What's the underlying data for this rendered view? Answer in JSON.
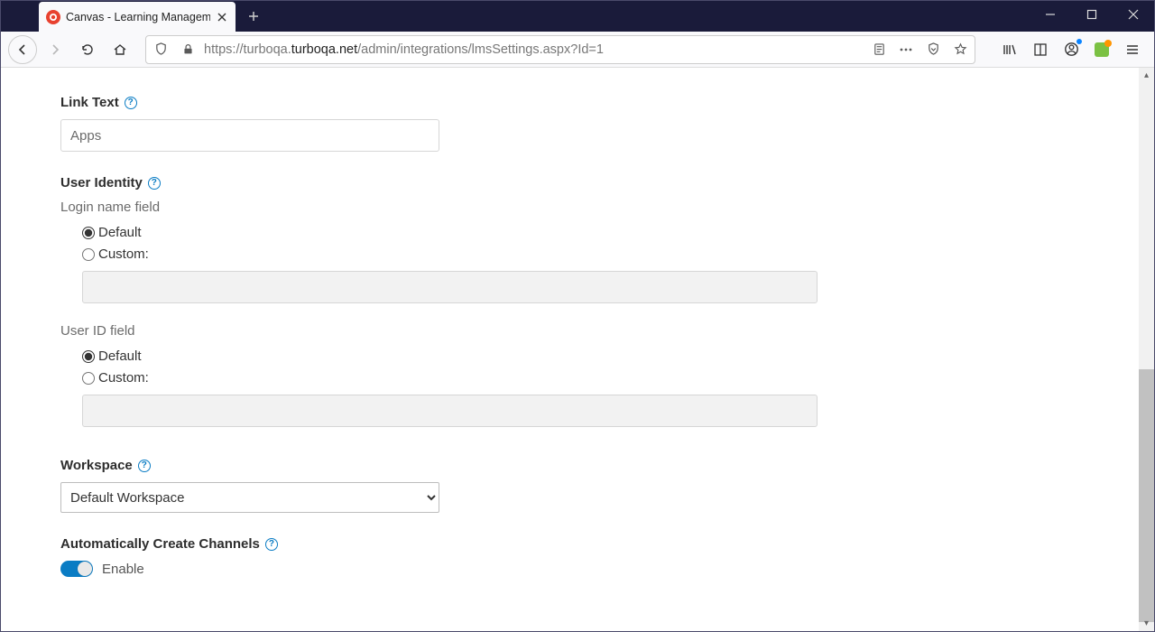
{
  "browser": {
    "tab_title": "Canvas - Learning Managemen",
    "url_prefix": "https://turboqa.",
    "url_domain": "turboqa.net",
    "url_path": "/admin/integrations/lmsSettings.aspx?Id=1"
  },
  "form": {
    "link_text": {
      "label": "Link Text",
      "value": "Apps"
    },
    "user_identity": {
      "label": "User Identity",
      "login_name": {
        "label": "Login name field",
        "default": "Default",
        "custom": "Custom:",
        "selected": "default",
        "custom_value": ""
      },
      "user_id": {
        "label": "User ID field",
        "default": "Default",
        "custom": "Custom:",
        "selected": "default",
        "custom_value": ""
      }
    },
    "workspace": {
      "label": "Workspace",
      "selected": "Default Workspace"
    },
    "auto_channels": {
      "label": "Automatically Create Channels",
      "toggle_label": "Enable",
      "enabled": true
    }
  }
}
